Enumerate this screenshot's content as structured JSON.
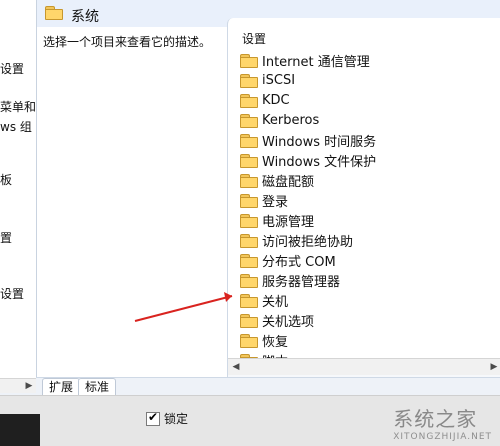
{
  "left_pane": {
    "truncated_items": [
      "设置",
      "菜单和",
      "ws 组",
      "板",
      "置",
      "设置"
    ]
  },
  "header": {
    "title": "系统"
  },
  "description": {
    "text": "选择一个项目来查看它的描述。"
  },
  "list": {
    "column_header": "设置",
    "items": [
      {
        "label": "Internet 通信管理"
      },
      {
        "label": "iSCSI"
      },
      {
        "label": "KDC"
      },
      {
        "label": "Kerberos"
      },
      {
        "label": "Windows 时间服务"
      },
      {
        "label": "Windows 文件保护"
      },
      {
        "label": "磁盘配额"
      },
      {
        "label": "登录"
      },
      {
        "label": "电源管理"
      },
      {
        "label": "访问被拒绝协助"
      },
      {
        "label": "分布式 COM"
      },
      {
        "label": "服务器管理器"
      },
      {
        "label": "关机"
      },
      {
        "label": "关机选项"
      },
      {
        "label": "恢复"
      },
      {
        "label": "脚本"
      }
    ]
  },
  "tabs": {
    "expand": "扩展",
    "standard": "标准"
  },
  "bottom": {
    "checkbox_label": "锁定"
  },
  "watermark": {
    "brand": "系统之家",
    "domain": "XITONGZHIJIA.NET"
  },
  "colors": {
    "annotation_arrow": "#d9231f",
    "folder_fill": "#ffd66b"
  }
}
